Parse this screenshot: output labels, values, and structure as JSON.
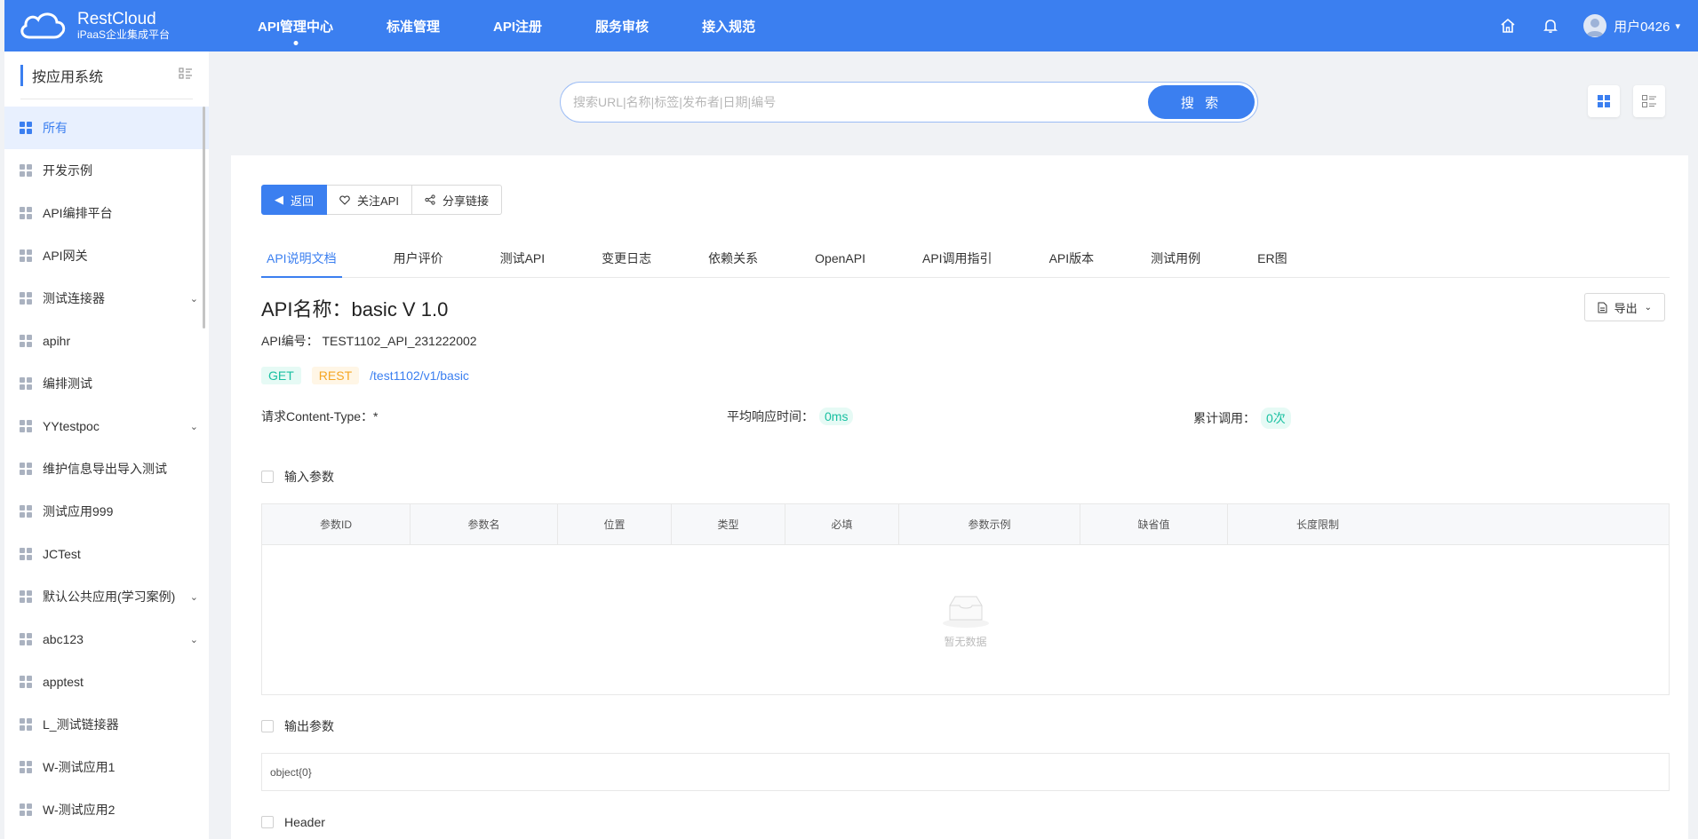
{
  "brand": {
    "name": "RestCloud",
    "subtitle": "iPaaS企业集成平台"
  },
  "topnav": {
    "items": [
      "API管理中心",
      "标准管理",
      "API注册",
      "服务审核",
      "接入规范"
    ],
    "active_index": 0
  },
  "user": {
    "name": "用户0426"
  },
  "sidebar": {
    "title": "按应用系统",
    "items": [
      {
        "label": "所有",
        "active": true
      },
      {
        "label": "开发示例"
      },
      {
        "label": "API编排平台"
      },
      {
        "label": "API网关"
      },
      {
        "label": "测试连接器",
        "expandable": true
      },
      {
        "label": "apihr"
      },
      {
        "label": "编排测试"
      },
      {
        "label": "YYtestpoc",
        "expandable": true
      },
      {
        "label": "维护信息导出导入测试"
      },
      {
        "label": "测试应用999"
      },
      {
        "label": "JCTest"
      },
      {
        "label": "默认公共应用(学习案例)",
        "expandable": true
      },
      {
        "label": "abc123",
        "expandable": true
      },
      {
        "label": "apptest"
      },
      {
        "label": "L_测试链接器"
      },
      {
        "label": "W-测试应用1"
      },
      {
        "label": "W-测试应用2"
      }
    ]
  },
  "search": {
    "placeholder": "搜索URL|名称|标签|发布者|日期|编号",
    "button": "搜 索",
    "value": ""
  },
  "actions": {
    "back": "返回",
    "follow": "关注API",
    "share": "分享链接"
  },
  "tabs": [
    "API说明文档",
    "用户评价",
    "测试API",
    "变更日志",
    "依赖关系",
    "OpenAPI",
    "API调用指引",
    "API版本",
    "测试用例",
    "ER图"
  ],
  "active_tab": 0,
  "api": {
    "name": "API名称：basic V 1.0",
    "code": "API编号：  TEST1102_API_231222002",
    "method": "GET",
    "type": "REST",
    "path": "/test1102/v1/basic",
    "content_type_label": "请求Content-Type：*",
    "avg_time_label": "平均响应时间：",
    "avg_time_value": "0ms",
    "total_calls_label": "累计调用：",
    "total_calls_value": "0次",
    "export": "导出"
  },
  "input_params": {
    "title": "输入参数",
    "columns": [
      "参数ID",
      "参数名",
      "位置",
      "类型",
      "必填",
      "参数示例",
      "缺省值",
      "长度限制"
    ],
    "rows": [],
    "empty_text": "暂无数据"
  },
  "output_params": {
    "title": "输出参数",
    "value": "object{0}"
  },
  "header_section": {
    "title": "Header"
  },
  "colors": {
    "primary": "#3b7ff0",
    "get": "#19c0a1",
    "rest": "#f5a623"
  }
}
